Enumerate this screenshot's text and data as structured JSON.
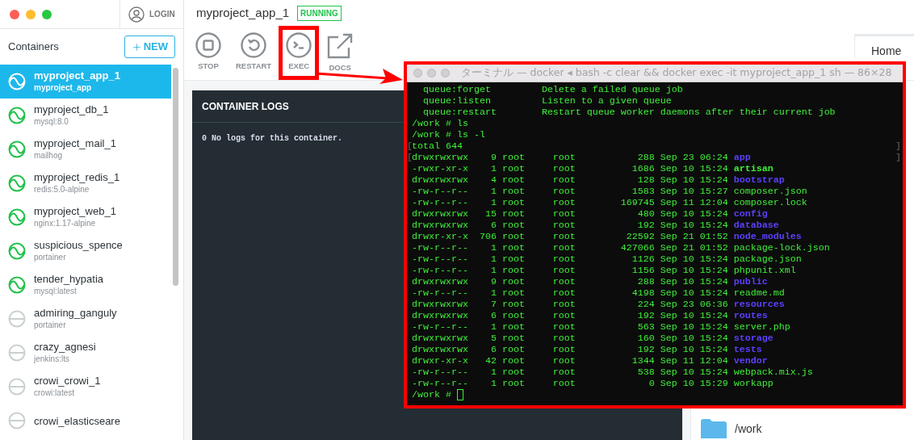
{
  "account": {
    "label": "LOGIN"
  },
  "sidebar": {
    "title": "Containers",
    "new_button": "NEW",
    "items": [
      {
        "name": "myproject_app_1",
        "image": "myproject_app",
        "selected": true,
        "running": true
      },
      {
        "name": "myproject_db_1",
        "image": "mysql:8.0",
        "selected": false,
        "running": true
      },
      {
        "name": "myproject_mail_1",
        "image": "mailhog",
        "selected": false,
        "running": true
      },
      {
        "name": "myproject_redis_1",
        "image": "redis:5.0-alpine",
        "selected": false,
        "running": true
      },
      {
        "name": "myproject_web_1",
        "image": "nginx:1.17-alpine",
        "selected": false,
        "running": true
      },
      {
        "name": "suspicious_spence",
        "image": "portainer",
        "selected": false,
        "running": true
      },
      {
        "name": "tender_hypatia",
        "image": "mysql:latest",
        "selected": false,
        "running": true
      },
      {
        "name": "admiring_ganguly",
        "image": "portainer",
        "selected": false,
        "running": false
      },
      {
        "name": "crazy_agnesi",
        "image": "jenkins:lts",
        "selected": false,
        "running": false
      },
      {
        "name": "crowi_crowi_1",
        "image": "crowi:latest",
        "selected": false,
        "running": false
      },
      {
        "name": "crowi_elasticseare",
        "selected": false,
        "running": false
      }
    ]
  },
  "container": {
    "name": "myproject_app_1",
    "status": "RUNNING",
    "actions": [
      {
        "label": "STOP",
        "kind": "stop",
        "highlighted": false
      },
      {
        "label": "RESTART",
        "kind": "restart",
        "highlighted": false
      },
      {
        "label": "EXEC",
        "kind": "exec",
        "highlighted": true
      },
      {
        "label": "DOCS",
        "kind": "docs",
        "highlighted": false
      }
    ]
  },
  "logs": {
    "title": "CONTAINER LOGS",
    "message": "0 No logs for this container."
  },
  "side_panel": {
    "tab": "Home",
    "folder": "/work"
  },
  "terminal": {
    "title": "ターミナル — docker ◂ bash -c clear && docker exec -it myproject_app_1 sh — 86×28",
    "highlighted": true,
    "lines": [
      {
        "kind": "text",
        "text": "  queue:forget         Delete a failed queue job"
      },
      {
        "kind": "text",
        "text": "  queue:listen         Listen to a given queue"
      },
      {
        "kind": "text",
        "text": "  queue:restart        Restart queue worker daemons after their current job"
      },
      {
        "kind": "text",
        "text": "/work # ls"
      },
      {
        "kind": "text",
        "text": "/work # ls -l"
      },
      {
        "kind": "text",
        "text": "total 644",
        "left_mark": "[",
        "right_mark": "]"
      },
      {
        "kind": "entry",
        "text": "drwxrwxrwx    9 root     root           288 Sep 23 06:24 ",
        "name": "app",
        "directory": true,
        "left_mark": "[",
        "right_mark": "]"
      },
      {
        "kind": "entry",
        "text": "-rwxr-xr-x    1 root     root          1686 Sep 10 15:24 ",
        "name": "artisan",
        "directory": false,
        "executable": true
      },
      {
        "kind": "entry",
        "text": "drwxrwxrwx    4 root     root           128 Sep 10 15:24 ",
        "name": "bootstrap",
        "directory": true
      },
      {
        "kind": "entry",
        "text": "-rw-r--r--    1 root     root          1583 Sep 10 15:27 ",
        "name": "composer.json",
        "directory": false,
        "executable": false
      },
      {
        "kind": "entry",
        "text": "-rw-r--r--    1 root     root        169745 Sep 11 12:04 ",
        "name": "composer.lock",
        "directory": false,
        "executable": false
      },
      {
        "kind": "entry",
        "text": "drwxrwxrwx   15 root     root           480 Sep 10 15:24 ",
        "name": "config",
        "directory": true
      },
      {
        "kind": "entry",
        "text": "drwxrwxrwx    6 root     root           192 Sep 10 15:24 ",
        "name": "database",
        "directory": true
      },
      {
        "kind": "entry",
        "text": "drwxr-xr-x  706 root     root         22592 Sep 21 01:52 ",
        "name": "node_modules",
        "directory": true
      },
      {
        "kind": "entry",
        "text": "-rw-r--r--    1 root     root        427066 Sep 21 01:52 ",
        "name": "package-lock.json",
        "directory": false,
        "executable": false
      },
      {
        "kind": "entry",
        "text": "-rw-r--r--    1 root     root          1126 Sep 10 15:24 ",
        "name": "package.json",
        "directory": false,
        "executable": false
      },
      {
        "kind": "entry",
        "text": "-rw-r--r--    1 root     root          1156 Sep 10 15:24 ",
        "name": "phpunit.xml",
        "directory": false,
        "executable": false
      },
      {
        "kind": "entry",
        "text": "drwxrwxrwx    9 root     root           288 Sep 10 15:24 ",
        "name": "public",
        "directory": true
      },
      {
        "kind": "entry",
        "text": "-rw-r--r--    1 root     root          4198 Sep 10 15:24 ",
        "name": "readme.md",
        "directory": false,
        "executable": false
      },
      {
        "kind": "entry",
        "text": "drwxrwxrwx    7 root     root           224 Sep 23 06:36 ",
        "name": "resources",
        "directory": true
      },
      {
        "kind": "entry",
        "text": "drwxrwxrwx    6 root     root           192 Sep 10 15:24 ",
        "name": "routes",
        "directory": true
      },
      {
        "kind": "entry",
        "text": "-rw-r--r--    1 root     root           563 Sep 10 15:24 ",
        "name": "server.php",
        "directory": false,
        "executable": false
      },
      {
        "kind": "entry",
        "text": "drwxrwxrwx    5 root     root           160 Sep 10 15:24 ",
        "name": "storage",
        "directory": true
      },
      {
        "kind": "entry",
        "text": "drwxrwxrwx    6 root     root           192 Sep 10 15:24 ",
        "name": "tests",
        "directory": true
      },
      {
        "kind": "entry",
        "text": "drwxr-xr-x   42 root     root          1344 Sep 11 12:04 ",
        "name": "vendor",
        "directory": true
      },
      {
        "kind": "entry",
        "text": "-rw-r--r--    1 root     root           538 Sep 10 15:24 ",
        "name": "webpack.mix.js",
        "directory": false,
        "executable": false
      },
      {
        "kind": "entry",
        "text": "-rw-r--r--    1 root     root             0 Sep 10 15:29 ",
        "name": "workapp",
        "directory": false,
        "executable": false
      },
      {
        "kind": "prompt",
        "text": "/work # ",
        "cursor": true
      }
    ]
  }
}
